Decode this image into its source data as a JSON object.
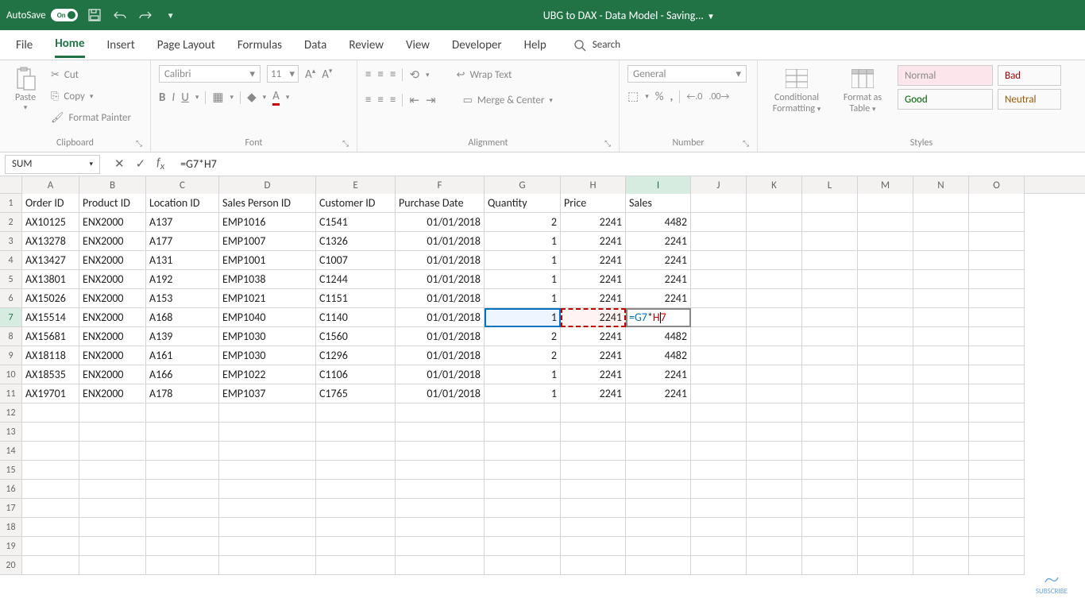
{
  "titlebar": {
    "autosave_label": "AutoSave",
    "autosave_state": "On",
    "doc_title": "UBG to DAX - Data Model -  Saving..."
  },
  "tabs": {
    "items": [
      "File",
      "Home",
      "Insert",
      "Page Layout",
      "Formulas",
      "Data",
      "Review",
      "View",
      "Developer",
      "Help"
    ],
    "active": "Home",
    "search_label": "Search"
  },
  "ribbon": {
    "clipboard": {
      "paste": "Paste",
      "cut": "Cut",
      "copy": "Copy",
      "painter": "Format Painter",
      "label": "Clipboard"
    },
    "font": {
      "name": "Calibri",
      "size": "11",
      "label": "Font"
    },
    "alignment": {
      "wrap": "Wrap Text",
      "merge": "Merge & Center",
      "label": "Alignment"
    },
    "number": {
      "format": "General",
      "label": "Number"
    },
    "cond": {
      "label1": "Conditional",
      "label2": "Formatting",
      "fmt1": "Format as",
      "fmt2": "Table"
    },
    "styles": {
      "normal": "Normal",
      "bad": "Bad",
      "good": "Good",
      "neutral": "Neutral",
      "label": "Styles"
    }
  },
  "formula_bar": {
    "name_box": "SUM",
    "formula": "=G7*H7",
    "cell_edit": "=G7*H7"
  },
  "grid": {
    "col_widths": {
      "A": 72,
      "B": 84,
      "C": 92,
      "D": 122,
      "E": 100,
      "F": 112,
      "G": 96,
      "H": 82,
      "I": 82,
      "J": 70,
      "K": 70,
      "L": 70,
      "M": 70,
      "N": 70,
      "O": 70
    },
    "columns": [
      "A",
      "B",
      "C",
      "D",
      "E",
      "F",
      "G",
      "H",
      "I",
      "J",
      "K",
      "L",
      "M",
      "N",
      "O"
    ],
    "headers": [
      "Order ID",
      "Product ID",
      "Location ID",
      "Sales Person ID",
      "Customer ID",
      "Purchase Date",
      "Quantity",
      "Price",
      "Sales"
    ],
    "rows": [
      {
        "A": "AX10125",
        "B": "ENX2000",
        "C": "A137",
        "D": "EMP1016",
        "E": "C1541",
        "F": "01/01/2018",
        "G": "2",
        "H": "2241",
        "I": "4482"
      },
      {
        "A": "AX13278",
        "B": "ENX2000",
        "C": "A177",
        "D": "EMP1007",
        "E": "C1326",
        "F": "01/01/2018",
        "G": "1",
        "H": "2241",
        "I": "2241"
      },
      {
        "A": "AX13427",
        "B": "ENX2000",
        "C": "A131",
        "D": "EMP1001",
        "E": "C1007",
        "F": "01/01/2018",
        "G": "1",
        "H": "2241",
        "I": "2241"
      },
      {
        "A": "AX13801",
        "B": "ENX2000",
        "C": "A192",
        "D": "EMP1038",
        "E": "C1244",
        "F": "01/01/2018",
        "G": "1",
        "H": "2241",
        "I": "2241"
      },
      {
        "A": "AX15026",
        "B": "ENX2000",
        "C": "A153",
        "D": "EMP1021",
        "E": "C1151",
        "F": "01/01/2018",
        "G": "1",
        "H": "2241",
        "I": "2241"
      },
      {
        "A": "AX15514",
        "B": "ENX2000",
        "C": "A168",
        "D": "EMP1040",
        "E": "C1140",
        "F": "01/01/2018",
        "G": "1",
        "H": "2241",
        "I": "=G7*H7"
      },
      {
        "A": "AX15681",
        "B": "ENX2000",
        "C": "A139",
        "D": "EMP1030",
        "E": "C1560",
        "F": "01/01/2018",
        "G": "2",
        "H": "2241",
        "I": "4482"
      },
      {
        "A": "AX18118",
        "B": "ENX2000",
        "C": "A161",
        "D": "EMP1030",
        "E": "C1296",
        "F": "01/01/2018",
        "G": "2",
        "H": "2241",
        "I": "4482"
      },
      {
        "A": "AX18535",
        "B": "ENX2000",
        "C": "A166",
        "D": "EMP1022",
        "E": "C1106",
        "F": "01/01/2018",
        "G": "1",
        "H": "2241",
        "I": "2241"
      },
      {
        "A": "AX19701",
        "B": "ENX2000",
        "C": "A178",
        "D": "EMP1037",
        "E": "C1765",
        "F": "01/01/2018",
        "G": "1",
        "H": "2241",
        "I": "2241"
      }
    ],
    "empty_rows": [
      12,
      13,
      14,
      15,
      16,
      17,
      18,
      19,
      20
    ],
    "active_cell": {
      "row": 7,
      "col": "I"
    },
    "ref_cells": [
      {
        "row": 7,
        "col": "G",
        "style": "blue"
      },
      {
        "row": 7,
        "col": "H",
        "style": "red"
      }
    ]
  },
  "watermark": "SUBSCRIBE"
}
